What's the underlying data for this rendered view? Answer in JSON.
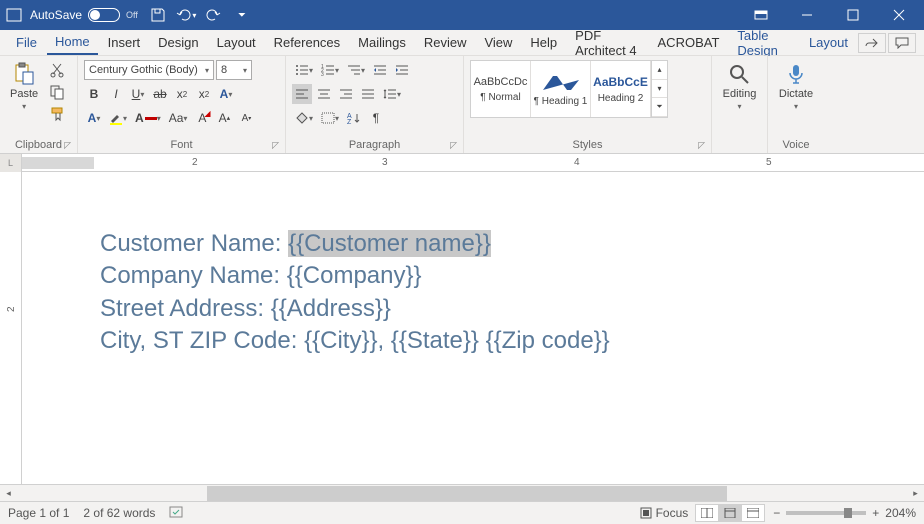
{
  "titlebar": {
    "autosave": "AutoSave",
    "autosave_state": "Off"
  },
  "tabs": {
    "file": "File",
    "home": "Home",
    "insert": "Insert",
    "design": "Design",
    "layout": "Layout",
    "references": "References",
    "mailings": "Mailings",
    "review": "Review",
    "view": "View",
    "help": "Help",
    "pdf_architect": "PDF Architect 4",
    "acrobat": "ACROBAT",
    "table_design": "Table Design",
    "layout2": "Layout"
  },
  "ribbon": {
    "clipboard": {
      "label": "Clipboard",
      "paste": "Paste"
    },
    "font": {
      "label": "Font",
      "name": "Century Gothic (Body)",
      "size": "8"
    },
    "paragraph": {
      "label": "Paragraph"
    },
    "styles": {
      "label": "Styles",
      "items": [
        {
          "preview": "AaBbCcDc",
          "name": "¶ Normal"
        },
        {
          "preview": "",
          "name": "¶ Heading 1"
        },
        {
          "preview": "AaBbCcE",
          "name": "Heading 2"
        }
      ]
    },
    "editing": {
      "label": "Editing"
    },
    "voice": {
      "label": "Voice",
      "dictate": "Dictate"
    }
  },
  "ruler": {
    "corner": "L",
    "marks": [
      "2",
      "3",
      "4",
      "5"
    ]
  },
  "vruler": {
    "marks": [
      "2"
    ]
  },
  "document": {
    "lines": [
      {
        "label": "Customer Name: ",
        "field": "{{Customer name}}",
        "selected": true
      },
      {
        "label": "Company Name: ",
        "field": "{{Company}}",
        "selected": false
      },
      {
        "label": "Street Address: ",
        "field": "{{Address}}",
        "selected": false
      },
      {
        "label": "City, ST  ZIP Code: ",
        "field": "{{City}}, {{State}} {{Zip code}}",
        "selected": false
      }
    ]
  },
  "statusbar": {
    "page": "Page 1 of 1",
    "words": "2 of 62 words",
    "focus": "Focus",
    "zoom": "204%"
  }
}
